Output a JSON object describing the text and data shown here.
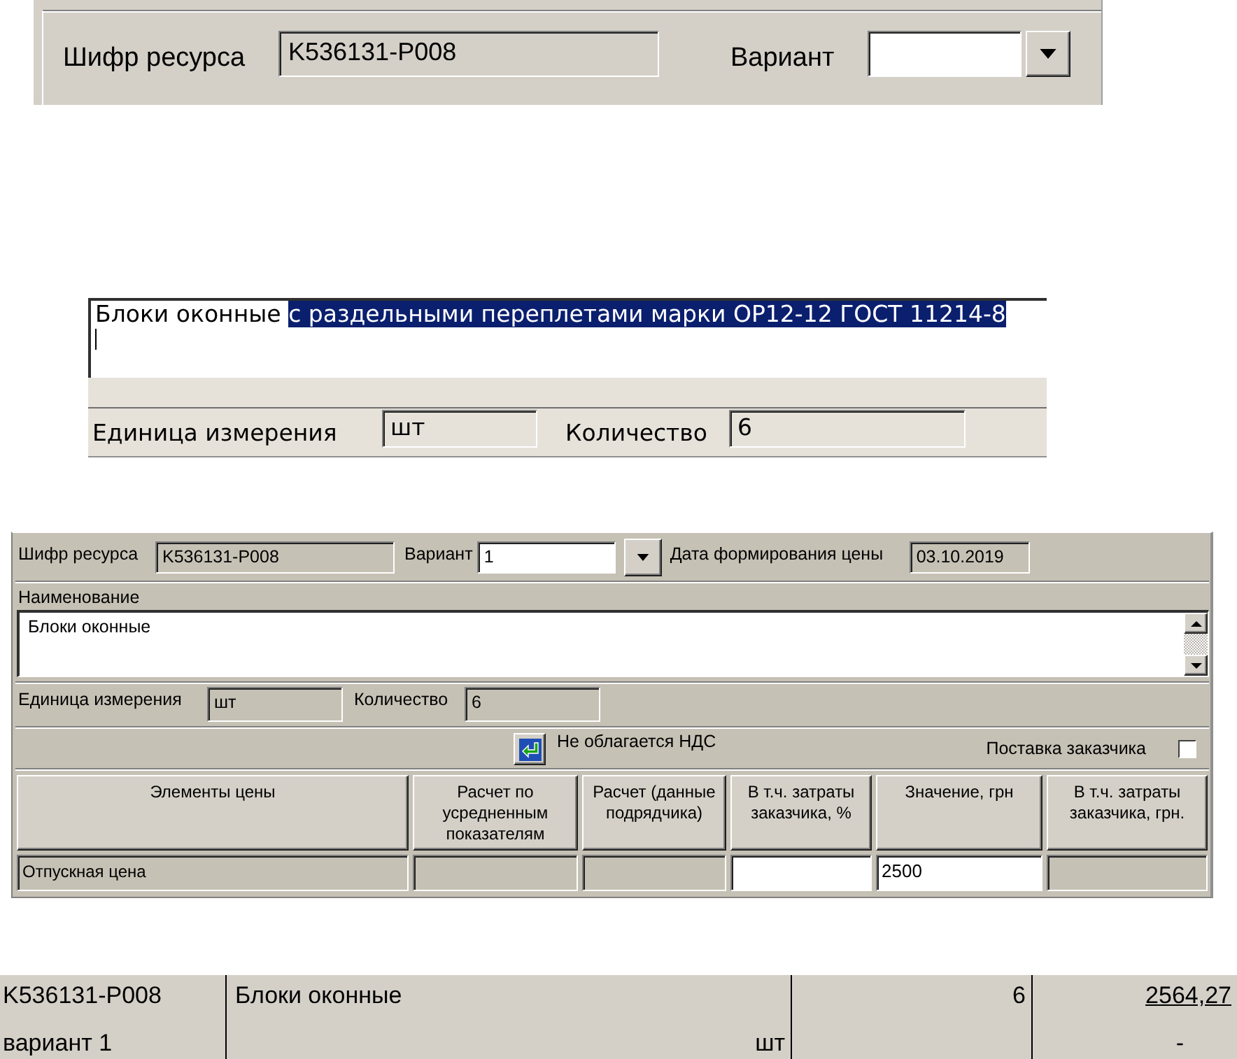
{
  "resource_header": {
    "resource_code": {
      "label": "Шифр ресурса",
      "value": "K536131-P008"
    },
    "variant": {
      "label": "Вариант"
    }
  },
  "name_editor": {
    "text": "Блоки оконные",
    "selected_text": "с раздельными переплетами марки ОР12-12 ГОСТ 11214-8",
    "unit": {
      "label": "Единица измерения",
      "value": "шт"
    },
    "quantity": {
      "label": "Количество",
      "value": "6"
    }
  },
  "price_form": {
    "resource_code": {
      "label": "Шифр ресурса",
      "value": "K536131-P008"
    },
    "variant": {
      "label": "Вариант",
      "value": "1"
    },
    "price_date": {
      "label": "Дата формирования цены",
      "value": "03.10.2019"
    },
    "name": {
      "label": "Наименование",
      "value": "Блоки оконные"
    },
    "unit": {
      "label": "Единица измерения",
      "value": "шт"
    },
    "quantity": {
      "label": "Количество",
      "value": "6"
    },
    "vat_exempt": {
      "label": "Не облагается НДС"
    },
    "customer_supply": {
      "label": "Поставка заказчика",
      "checked": false
    },
    "table": {
      "columns": [
        "Элементы цены",
        "Расчет по усредненным показателям",
        "Расчет (данные подрядчика)",
        "В т.ч. затраты заказчика, %",
        "Значение, грн",
        "В т.ч. затраты заказчика, грн."
      ],
      "rows": [
        {
          "cells": [
            {
              "kind": "text",
              "value": "Отпускная цена"
            },
            {
              "kind": "readonly"
            },
            {
              "kind": "readonly"
            },
            {
              "kind": "input"
            },
            {
              "kind": "input",
              "value": "2500"
            },
            {
              "kind": "readonly"
            }
          ]
        }
      ]
    }
  },
  "summary_row": {
    "code": "K536131-P008",
    "variant": "вариант 1",
    "name": "Блоки оконные",
    "unit": "шт",
    "quantity": "6",
    "amount": "2564,27",
    "amount_note": "-"
  }
}
